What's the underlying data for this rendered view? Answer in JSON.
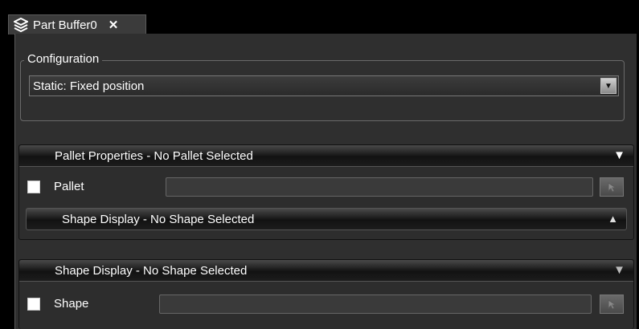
{
  "tab": {
    "title": "Part Buffer0",
    "close_glyph": "✕",
    "icon": "layers-icon"
  },
  "configuration": {
    "legend": "Configuration",
    "selected": "Static: Fixed position",
    "dropdown_glyph": "▼"
  },
  "pallet_section": {
    "header": "Pallet Properties - No Pallet Selected",
    "chevron": "▼",
    "checkbox_label": "Pallet",
    "field_value": "",
    "shape_display": {
      "header": "Shape Display - No Shape Selected",
      "chevron": "▲"
    }
  },
  "shape_section": {
    "header": "Shape Display - No Shape Selected",
    "chevron": "▼",
    "checkbox_label": "Shape",
    "field_value": ""
  },
  "colors": {
    "background": "#2f2f2f",
    "header_dark": "#121212",
    "text": "#ffffff"
  }
}
